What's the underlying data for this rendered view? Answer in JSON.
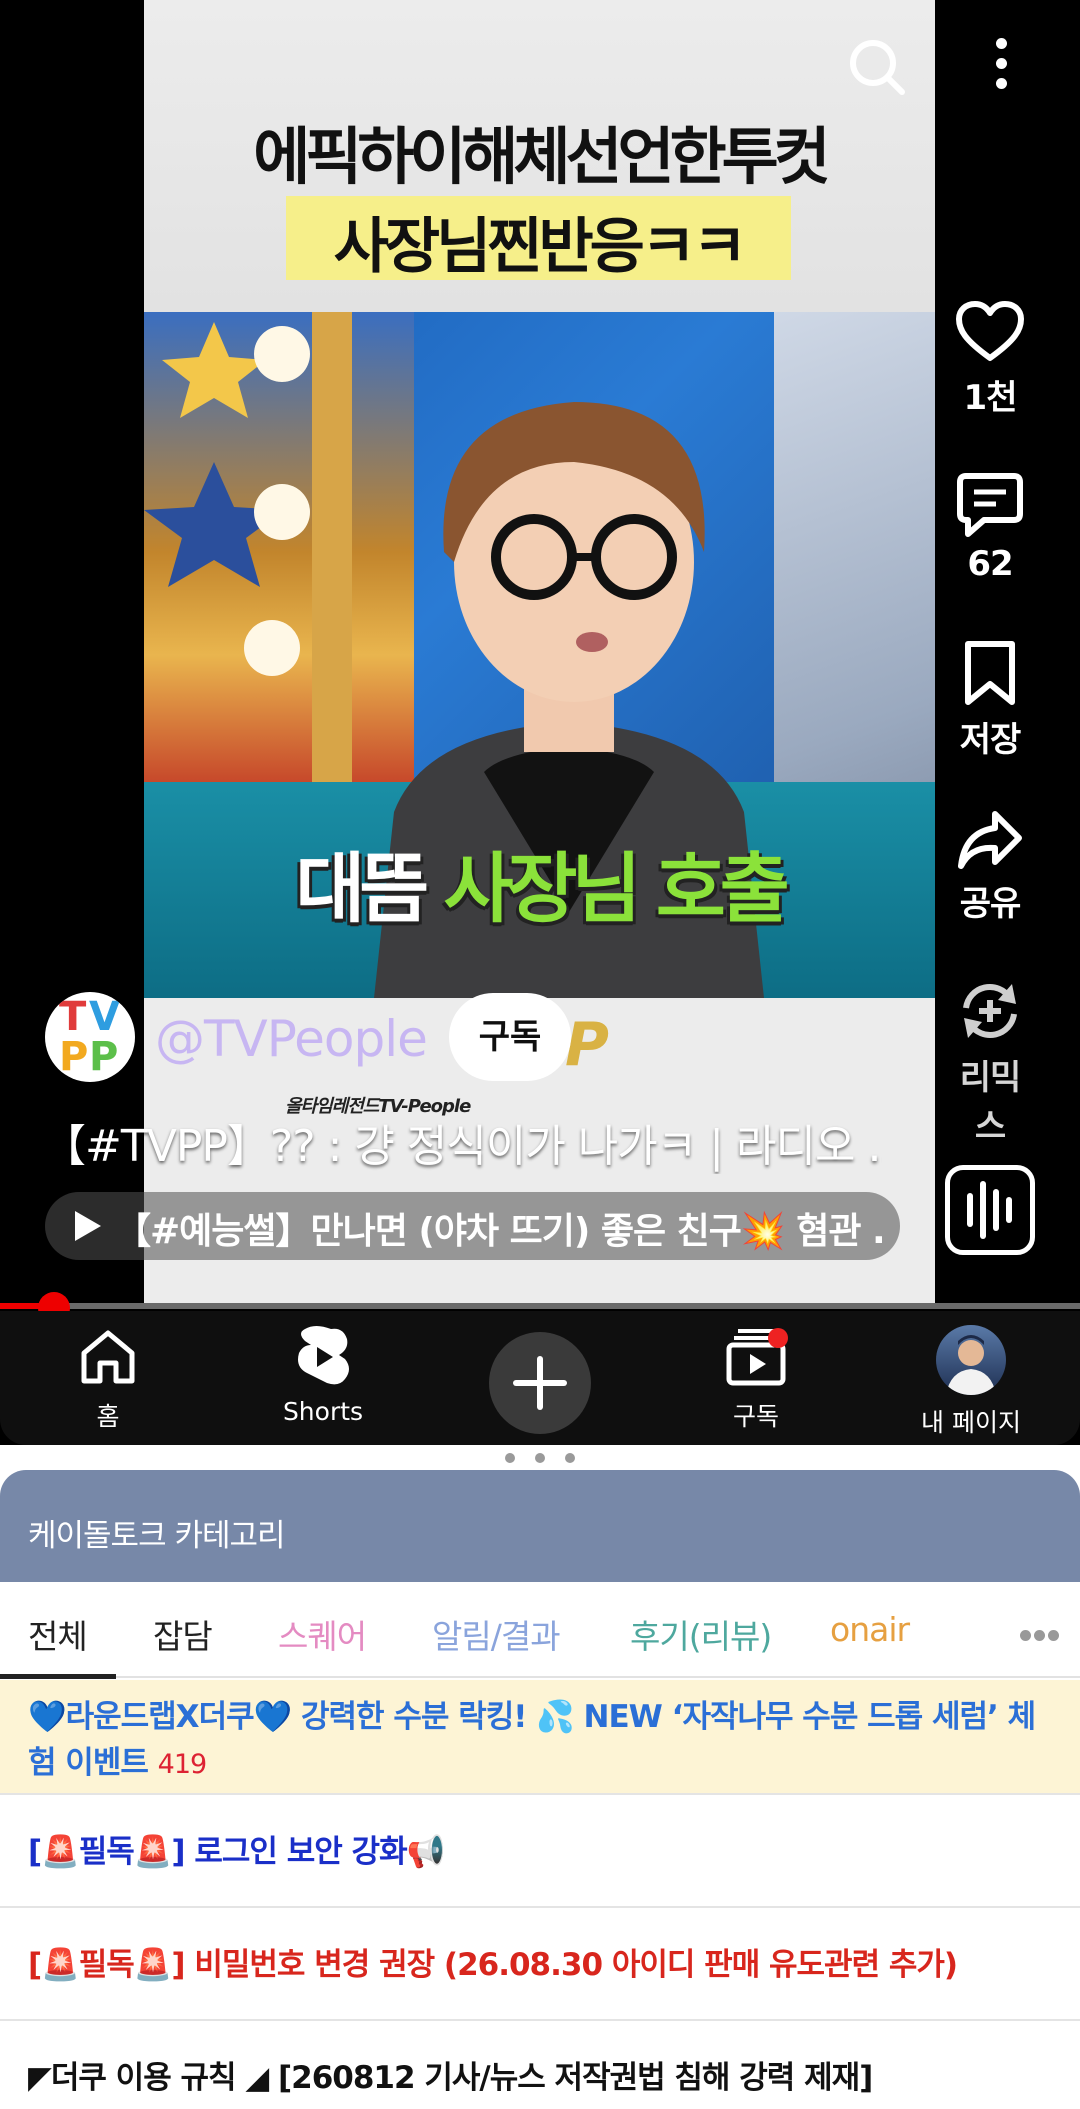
{
  "video": {
    "caption_top": "에픽하이해체선언한투컷",
    "caption_highlight": "사장님찐반응ㅋㅋ",
    "overlay_caption_white": "대뜸",
    "overlay_caption_green": "사장님 호출",
    "watermark": "올타임레전드TV-People",
    "watermark_letter": "P",
    "channel": {
      "avatar_text": "TVPP",
      "handle": "@TVPeople",
      "subscribe_label": "구독"
    },
    "title": "【#TVPP】?? : 걍 정식이가 나가ㅋ | 라디오 ...",
    "related": "【#예능썰】만나면 (야차 뜨기) 좋은 친구💥 혐관 ...",
    "progress": 0.05
  },
  "actions": {
    "like_count": "1천",
    "comment_count": "62",
    "save_label": "저장",
    "share_label": "공유",
    "remix_label": "리믹스"
  },
  "nav": {
    "home": "홈",
    "shorts": "Shorts",
    "subscriptions": "구독",
    "my_page": "내 페이지"
  },
  "panel": {
    "title": "케이돌토크 카테고리",
    "tabs": [
      {
        "label": "전체",
        "color": "#222222"
      },
      {
        "label": "잡담",
        "color": "#222222"
      },
      {
        "label": "스퀘어",
        "color": "#e48bc2"
      },
      {
        "label": "알림/결과",
        "color": "#8aa4dc"
      },
      {
        "label": "후기(리뷰)",
        "color": "#4ea89e"
      },
      {
        "label": "onair",
        "color": "#e6a041"
      }
    ],
    "posts": [
      {
        "text": "💙라운드랩X더쿠💙 강력한 수분 락킹! 💦 NEW ‘자작나무 수분 드롭 세럼’ 체험 이벤트",
        "count": "419",
        "color": "#2b6fd6"
      },
      {
        "text": "[🚨필독🚨] 로그인 보안 강화📢",
        "color": "#1a2fc8"
      },
      {
        "text": "[🚨필독🚨] 비밀번호 변경 권장 (26.08.30 아이디 판매 유도관련 추가)",
        "color": "#d8261d"
      },
      {
        "text": "◤더쿠 이용 규칙 ◢ [260812 기사/뉴스 저작권법 침해 강력 제재]",
        "color": "#111111"
      }
    ]
  }
}
